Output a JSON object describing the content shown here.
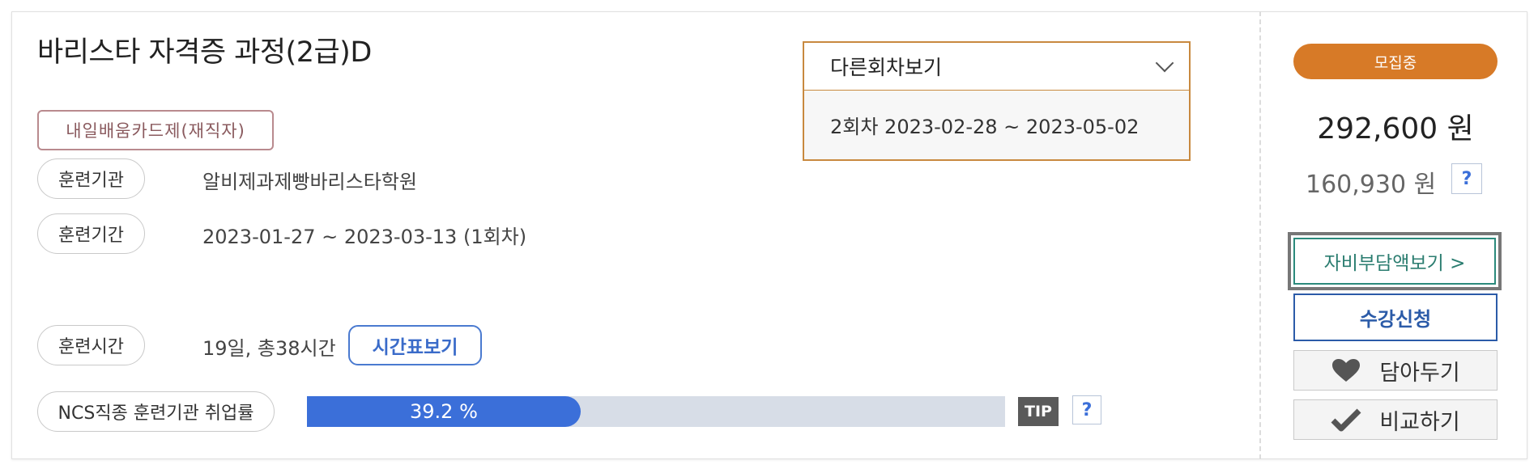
{
  "course": {
    "title": "바리스타 자격증 과정(2급)D",
    "card_type": "내일배움카드제(재직자)"
  },
  "details": [
    {
      "label": "훈련기관",
      "value": "알비제과제빵바리스타학원"
    },
    {
      "label": "훈련기간",
      "value": "2023-01-27 ~ 2023-03-13 (1회차)"
    },
    {
      "label": "훈련시간",
      "value": "19일, 총38시간"
    }
  ],
  "timetable_button": "시간표보기",
  "employment": {
    "label": "NCS직종 훈련기관 취업률",
    "rate_percent": 39.2,
    "rate_text": "39.2 %",
    "tip": "TIP",
    "help": "?"
  },
  "session_dropdown": {
    "label": "다른회차보기",
    "options": [
      "2회차 2023-02-28 ~ 2023-05-02"
    ]
  },
  "sidebar": {
    "status": "모집중",
    "price": "292,600 원",
    "self_pay": "160,930 원",
    "help": "?",
    "copay_button": "자비부담액보기 >",
    "enroll_button": "수강신청",
    "save_button": "담아두기",
    "compare_button": "비교하기"
  },
  "colors": {
    "accent_orange": "#d77a27",
    "progress_blue": "#3b6fd9",
    "enroll_blue": "#2b5ba8",
    "copay_teal": "#2b8a7c",
    "dropdown_border": "#c8893f"
  },
  "icons": {
    "save": "heart-icon",
    "compare": "check-icon",
    "dropdown": "chevron-down-icon"
  }
}
